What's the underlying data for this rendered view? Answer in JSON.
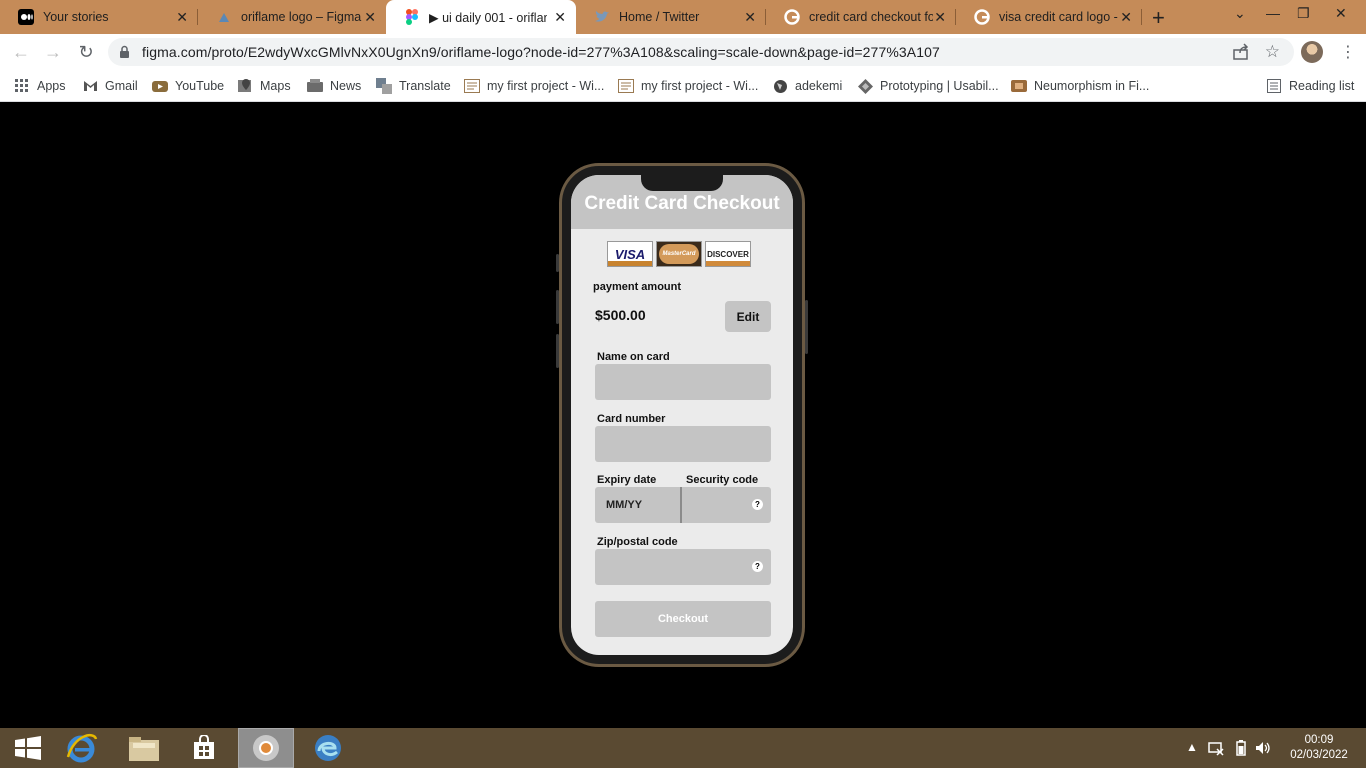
{
  "browser": {
    "tabs": [
      {
        "title": "Your stories",
        "icon": "medium-icon"
      },
      {
        "title": "oriflame logo – Figma",
        "icon": "figma-icon"
      },
      {
        "title": "▶ ui daily 001 - oriflam",
        "icon": "figma-icon"
      },
      {
        "title": "Home / Twitter",
        "icon": "twitter-icon"
      },
      {
        "title": "credit card checkout fo",
        "icon": "google-icon"
      },
      {
        "title": "visa credit card logo - s",
        "icon": "google-icon"
      }
    ],
    "new_tab_label": "+",
    "url": "figma.com/proto/E2wdyWxcGMlvNxX0UgnXn9/oriflame-logo?node-id=277%3A108&scaling=scale-down&page-id=277%3A107",
    "bookmarks": [
      {
        "label": "Apps",
        "icon": "apps-grid-icon"
      },
      {
        "label": "Gmail",
        "icon": "gmail-icon"
      },
      {
        "label": "YouTube",
        "icon": "youtube-icon"
      },
      {
        "label": "Maps",
        "icon": "maps-icon"
      },
      {
        "label": "News",
        "icon": "news-icon"
      },
      {
        "label": "Translate",
        "icon": "translate-icon"
      },
      {
        "label": "my first project - Wi...",
        "icon": "page-icon"
      },
      {
        "label": "my first project - Wi...",
        "icon": "page-icon"
      },
      {
        "label": "adekemi",
        "icon": "globe-icon"
      },
      {
        "label": "Prototyping | Usabil...",
        "icon": "diamond-icon"
      },
      {
        "label": "Neumorphism in Fi...",
        "icon": "page-icon"
      }
    ],
    "reading_list": "Reading list",
    "colors": {
      "tabstrip": "#c58b58",
      "taskbar": "#5a4a32"
    }
  },
  "checkout": {
    "title": "Credit Card Checkout",
    "cards": [
      "VISA",
      "MasterCard",
      "DISCOVER"
    ],
    "payment_amount_label": "payment amount",
    "amount": "$500.00",
    "edit_label": "Edit",
    "name_label": "Name on card",
    "card_number_label": "Card number",
    "expiry_label": "Expiry date",
    "expiry_placeholder": "MM/YY",
    "security_label": "Security code",
    "help_symbol": "?",
    "zip_label": "Zip/postal code",
    "checkout_label": "Checkout",
    "colors": {
      "field": "#c4c4c4",
      "screen": "#ebebeb",
      "header": "#c4c4c4"
    }
  },
  "taskbar": {
    "time": "00:09",
    "date": "02/03/2022"
  }
}
